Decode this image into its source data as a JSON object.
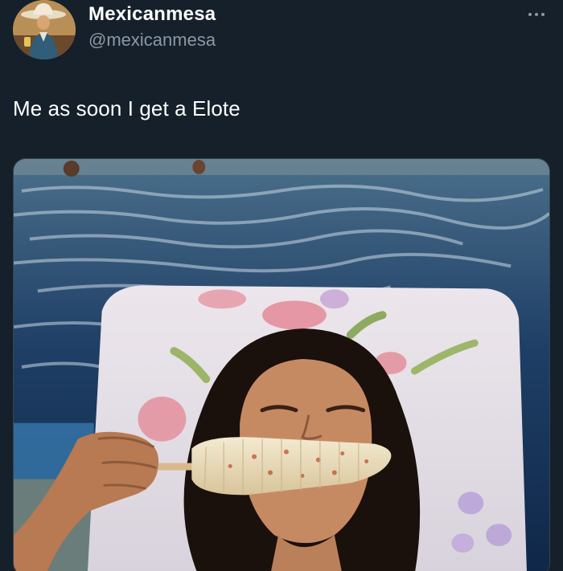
{
  "tweet": {
    "author": {
      "display_name": "Mexicanmesa",
      "handle": "@mexicanmesa",
      "avatar_icon": "avatar-charro-icon"
    },
    "more_icon": "more-horizontal-icon",
    "text": "Me as soon I get a Elote",
    "media": {
      "type": "photo",
      "subject": "person on pool lounger eating elote"
    }
  },
  "colors": {
    "background": "#15202b",
    "primary_text": "#ffffff",
    "secondary_text": "#8b98a5",
    "border": "#38444d"
  }
}
